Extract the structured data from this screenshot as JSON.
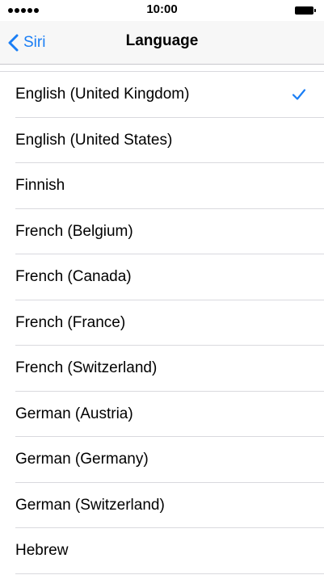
{
  "status_bar": {
    "time": "10:00"
  },
  "nav": {
    "back_label": "Siri",
    "title": "Language"
  },
  "accent_color": "#1a7ef5",
  "languages": [
    {
      "label": "English (United Kingdom)",
      "selected": true
    },
    {
      "label": "English (United States)",
      "selected": false
    },
    {
      "label": "Finnish",
      "selected": false
    },
    {
      "label": "French (Belgium)",
      "selected": false
    },
    {
      "label": "French (Canada)",
      "selected": false
    },
    {
      "label": "French (France)",
      "selected": false
    },
    {
      "label": "French (Switzerland)",
      "selected": false
    },
    {
      "label": "German (Austria)",
      "selected": false
    },
    {
      "label": "German (Germany)",
      "selected": false
    },
    {
      "label": "German (Switzerland)",
      "selected": false
    },
    {
      "label": "Hebrew",
      "selected": false
    }
  ]
}
